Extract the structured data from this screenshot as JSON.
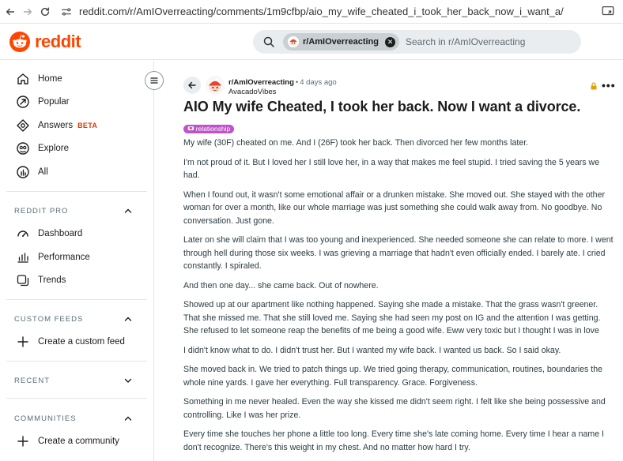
{
  "browser": {
    "url": "reddit.com/r/AmIOverreacting/comments/1m9cfbp/aio_my_wife_cheated_i_took_her_back_now_i_want_a/"
  },
  "header": {
    "logo_text": "reddit",
    "search": {
      "chip_label": "r/AmIOverreacting",
      "placeholder": "Search in r/AmIOverreacting"
    }
  },
  "sidebar": {
    "items": [
      {
        "label": "Home",
        "icon": "home-icon"
      },
      {
        "label": "Popular",
        "icon": "popular-icon"
      },
      {
        "label": "Answers",
        "icon": "answers-icon",
        "badge": "BETA"
      },
      {
        "label": "Explore",
        "icon": "explore-icon"
      },
      {
        "label": "All",
        "icon": "all-icon"
      }
    ],
    "sections": {
      "reddit_pro": {
        "title": "REDDIT PRO",
        "items": [
          {
            "label": "Dashboard",
            "icon": "dashboard-icon"
          },
          {
            "label": "Performance",
            "icon": "performance-icon"
          },
          {
            "label": "Trends",
            "icon": "trends-icon"
          }
        ]
      },
      "custom_feeds": {
        "title": "CUSTOM FEEDS",
        "items": [
          {
            "label": "Create a custom feed",
            "icon": "plus-icon"
          }
        ]
      },
      "recent": {
        "title": "RECENT"
      },
      "communities": {
        "title": "COMMUNITIES",
        "items": [
          {
            "label": "Create a community",
            "icon": "plus-icon"
          }
        ]
      }
    }
  },
  "post": {
    "subreddit": "r/AmIOverreacting",
    "separator": "•",
    "time": "4 days ago",
    "author": "AvacadoVibes",
    "title": "AIO My wife Cheated, I took her back. Now I want a divorce.",
    "flair": "relationship",
    "paragraphs": [
      "My wife (30F) cheated on me. And I (26F) took her back. Then divorced her few months later.",
      "I'm not proud of it. But I loved her I still love her, in a way that makes me feel stupid. I tried saving the 5 years we had.",
      "When I found out, it wasn't some emotional affair or a drunken mistake. She moved out. She stayed with the other woman for over a month, like our whole marriage was just something she could walk away from. No goodbye. No conversation. Just gone.",
      "Later on she will claim that I was too young and inexperienced. She needed someone she can relate to more. I went through hell during those six weeks. I was grieving a marriage that hadn't even officially ended. I barely ate. I cried constantly. I spiraled.",
      "And then one day... she came back. Out of nowhere.",
      "Showed up at our apartment like nothing happened. Saying she made a mistake. That the grass wasn't greener. That she missed me. That she still loved me. Saying she had seen my post on IG and the attention I was getting. She refused to let someone reap the benefits of me being a good wife. Eww very toxic but I thought I was in love",
      "I didn't know what to do. I didn't trust her. But I wanted my wife back. I wanted us back. So I said okay.",
      "She moved back in. We tried to patch things up. We tried going therapy, communication, routines, boundaries the whole nine yards. I gave her everything. Full transparency. Grace. Forgiveness.",
      "Something in me never healed. Even the way she kissed me didn't seem right. I felt like she being possessive and controlling. Like I was her prize.",
      "Every time she touches her phone a little too long. Every time she's late coming home. Every time I hear a name I don't recognize. There's this weight in my chest. And no matter how hard I try."
    ]
  },
  "colors": {
    "brand": "#ff4500",
    "flair_bg": "#c052c9",
    "beta": "#d93900",
    "lock": "#e2a100"
  }
}
